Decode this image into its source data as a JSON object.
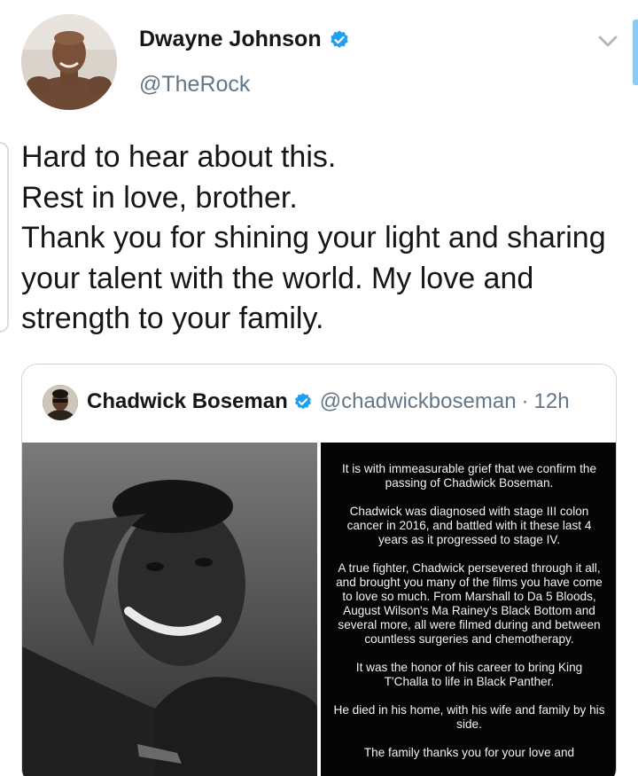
{
  "author": {
    "name": "Dwayne Johnson",
    "handle": "@TheRock",
    "verified": true,
    "avatar_icon": "profile-photo"
  },
  "menu_icon": "chevron-down-icon",
  "tweet_text": "Hard to hear about this.\nRest in love, brother.\nThank you for shining your light and sharing your talent with the world. My love and strength to your family.",
  "quoted_tweet": {
    "name": "Chadwick Boseman",
    "handle": "@chadwickboseman",
    "separator": "·",
    "time": "12h",
    "verified": true,
    "statement_paragraphs": [
      "It is with immeasurable grief that we confirm the passing of Chadwick Boseman.",
      "Chadwick was diagnosed with stage III colon cancer in 2016, and battled with it these last 4 years as it progressed to stage IV.",
      "A true fighter, Chadwick persevered through it all, and brought you many of the films you have come to love so much. From Marshall to Da 5 Bloods, August Wilson's Ma Rainey's Black Bottom and several more, all were filmed during and between countless surgeries and chemotherapy.",
      "It was the honor of his career to bring King T'Challa to life in Black Panther.",
      "He died in his home, with his wife and family by his side.",
      "The family thanks you for your love and"
    ]
  },
  "colors": {
    "text": "#14171a",
    "secondary": "#657786",
    "verified": "#1da1f2",
    "border": "#ccd6dd",
    "statement_bg": "#050505"
  }
}
